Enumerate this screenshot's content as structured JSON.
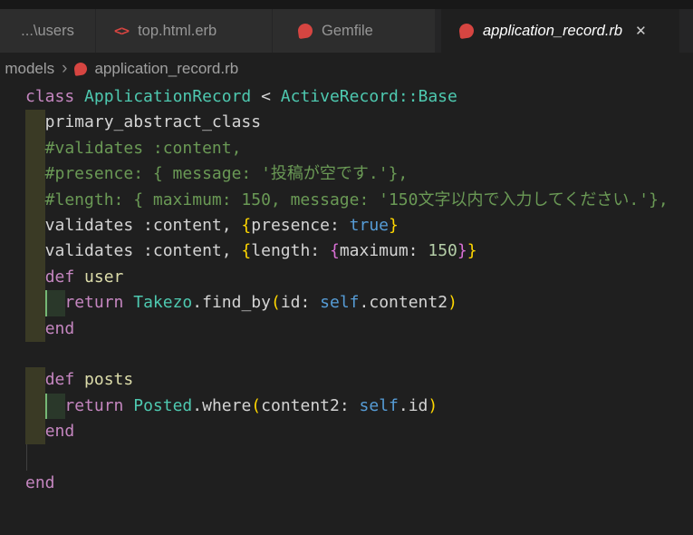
{
  "colors": {
    "titlebar-bg": "#181818",
    "tabbar-bg": "#252526",
    "tab-inactive-bg": "#2d2d2d",
    "tab-active-bg": "#1f1f1f",
    "tab-inactive-fg": "#969696",
    "tab-active-fg": "#ffffff",
    "editor-bg": "#1f1f1f",
    "breadcrumb-fg": "#a0a0a0",
    "accent-red": "#d64541",
    "close-fg": "#cccccc",
    "indent1": "#3a3a25",
    "indent2": "#2a382a",
    "indent-guide-active": "#75b875",
    "indent-guide": "#3f3f3f"
  },
  "tabs": [
    {
      "label": "...\\users",
      "icon": "none",
      "active": false
    },
    {
      "label": "top.html.erb",
      "icon": "erb",
      "icon_glyph": "<>",
      "active": false
    },
    {
      "label": "Gemfile",
      "icon": "ruby",
      "active": false
    },
    {
      "label": "application_record.rb",
      "icon": "ruby",
      "active": true,
      "close_glyph": "✕"
    }
  ],
  "breadcrumb": {
    "separator": "›",
    "items": [
      "models",
      "application_record.rb"
    ]
  },
  "code": {
    "palette": {
      "kw": "#C586C0",
      "ty": "#4EC9B0",
      "pl": "#D4D4D4",
      "cm": "#6A9955",
      "bl": "#569CD6",
      "nu": "#B5CEA8",
      "b1": "#FFD700",
      "b2": "#DA70D6",
      "fn": "#DCDCAA"
    },
    "lines": [
      {
        "deco": [],
        "tokens": [
          [
            "class",
            "kw"
          ],
          [
            " ",
            "pl"
          ],
          [
            "ApplicationRecord",
            "ty"
          ],
          [
            " < ",
            "pl"
          ],
          [
            "ActiveRecord::Base",
            "ty"
          ]
        ]
      },
      {
        "deco": [
          "d1"
        ],
        "tokens": [
          [
            "  primary_abstract_class",
            "pl"
          ]
        ]
      },
      {
        "deco": [
          "d1"
        ],
        "tokens": [
          [
            "  #validates :content,",
            "cm"
          ]
        ]
      },
      {
        "deco": [
          "d1"
        ],
        "tokens": [
          [
            "  #presence: { message: '投稿が空です.'},",
            "cm"
          ]
        ]
      },
      {
        "deco": [
          "d1"
        ],
        "tokens": [
          [
            "  #length: { maximum: 150, message: '150文字以内で入力してください.'},",
            "cm"
          ]
        ]
      },
      {
        "deco": [
          "d1"
        ],
        "tokens": [
          [
            "  validates :content, ",
            "pl"
          ],
          [
            "{",
            "b1"
          ],
          [
            "presence: ",
            "pl"
          ],
          [
            "true",
            "bl"
          ],
          [
            "}",
            "b1"
          ]
        ]
      },
      {
        "deco": [
          "d1"
        ],
        "tokens": [
          [
            "  validates :content, ",
            "pl"
          ],
          [
            "{",
            "b1"
          ],
          [
            "length: ",
            "pl"
          ],
          [
            "{",
            "b2"
          ],
          [
            "maximum: ",
            "pl"
          ],
          [
            "150",
            "nu"
          ],
          [
            "}",
            "b2"
          ],
          [
            "}",
            "b1"
          ]
        ]
      },
      {
        "deco": [
          "d1"
        ],
        "tokens": [
          [
            "  ",
            "pl"
          ],
          [
            "def",
            "kw"
          ],
          [
            " ",
            "pl"
          ],
          [
            "user",
            "fn"
          ]
        ]
      },
      {
        "deco": [
          "d1",
          "d2"
        ],
        "tokens": [
          [
            "    ",
            "pl"
          ],
          [
            "return",
            "kw"
          ],
          [
            " ",
            "pl"
          ],
          [
            "Takezo",
            "ty"
          ],
          [
            ".find_by",
            "pl"
          ],
          [
            "(",
            "b1"
          ],
          [
            "id: ",
            "pl"
          ],
          [
            "self",
            "bl"
          ],
          [
            ".content2",
            "pl"
          ],
          [
            ")",
            "b1"
          ]
        ]
      },
      {
        "deco": [
          "d1"
        ],
        "tokens": [
          [
            "  ",
            "pl"
          ],
          [
            "end",
            "kw"
          ]
        ]
      },
      {
        "deco": [],
        "tokens": []
      },
      {
        "deco": [
          "d1"
        ],
        "tokens": [
          [
            "  ",
            "pl"
          ],
          [
            "def",
            "kw"
          ],
          [
            " ",
            "pl"
          ],
          [
            "posts",
            "fn"
          ]
        ]
      },
      {
        "deco": [
          "d1",
          "d2"
        ],
        "tokens": [
          [
            "    ",
            "pl"
          ],
          [
            "return",
            "kw"
          ],
          [
            " ",
            "pl"
          ],
          [
            "Posted",
            "ty"
          ],
          [
            ".where",
            "pl"
          ],
          [
            "(",
            "b1"
          ],
          [
            "content2: ",
            "pl"
          ],
          [
            "self",
            "bl"
          ],
          [
            ".id",
            "pl"
          ],
          [
            ")",
            "b1"
          ]
        ]
      },
      {
        "deco": [
          "d1"
        ],
        "tokens": [
          [
            "  ",
            "pl"
          ],
          [
            "end",
            "kw"
          ]
        ]
      },
      {
        "deco": [
          "g0"
        ],
        "tokens": []
      },
      {
        "deco": [],
        "tokens": [
          [
            "end",
            "kw"
          ]
        ]
      }
    ]
  }
}
